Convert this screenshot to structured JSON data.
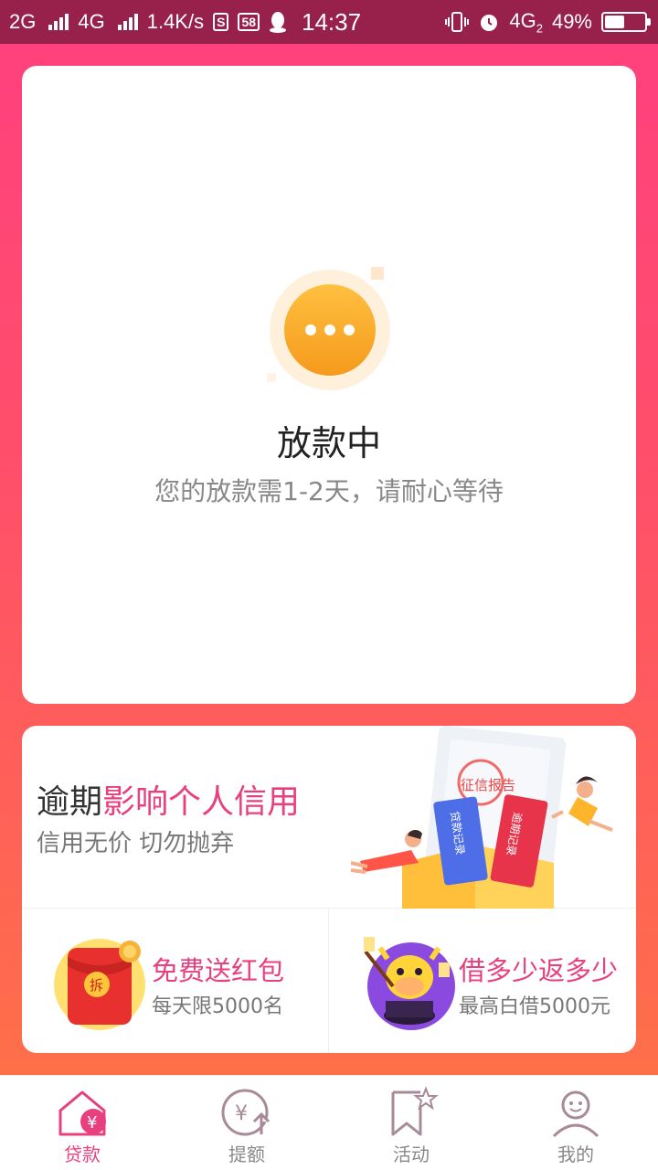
{
  "status_bar": {
    "net1": "2G",
    "net2": "4G",
    "speed": "1.4K/s",
    "badge_s": "S",
    "badge_58": "58",
    "time": "14:37",
    "net3": "4G",
    "net3_sub": "2",
    "battery": "49%",
    "battery_level": 0.49
  },
  "status_card": {
    "title": "放款中",
    "subtitle": "您的放款需1-2天，请耐心等待"
  },
  "banner": {
    "title_plain": "逾期",
    "title_highlight": "影响个人信用",
    "subtitle": "信用无价  切勿抛弃",
    "art_label_report": "征信报告",
    "art_label_loan": "贷款记录",
    "art_label_overdue": "逾期记录"
  },
  "promos": [
    {
      "title": "免费送红包",
      "subtitle": "每天限5000名",
      "icon_text": "拆"
    },
    {
      "title": "借多少返多少",
      "subtitle": "最高白借5000元"
    }
  ],
  "tabs": [
    {
      "label": "贷款",
      "icon": "loan-icon",
      "active": true
    },
    {
      "label": "提额",
      "icon": "raise-limit-icon",
      "active": false
    },
    {
      "label": "活动",
      "icon": "activity-icon",
      "active": false
    },
    {
      "label": "我的",
      "icon": "profile-icon",
      "active": false
    }
  ],
  "colors": {
    "accent": "#e8407e",
    "statusbar": "#97214a",
    "bg_top": "#ff3f7f",
    "bg_bottom": "#ff7a40"
  }
}
